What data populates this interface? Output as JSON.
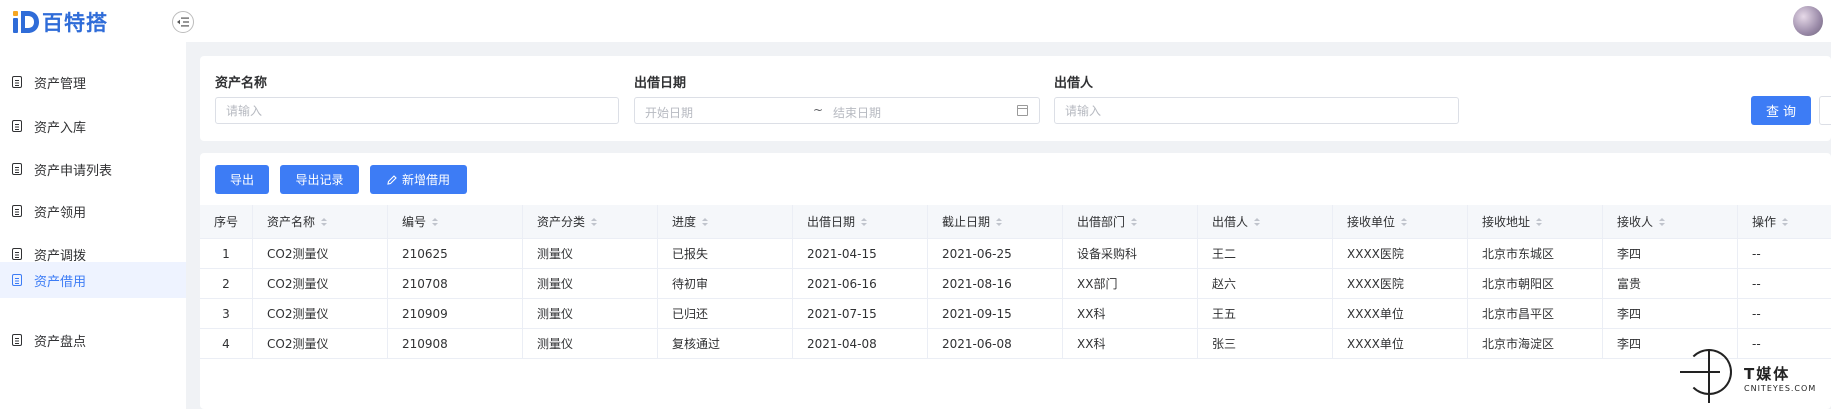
{
  "app": {
    "logo_text": "百特搭",
    "brand_color": "#3d7cf5"
  },
  "sidebar": {
    "items": [
      {
        "label": "资产管理",
        "active": false
      },
      {
        "label": "资产入库",
        "active": false
      },
      {
        "label": "资产申请列表",
        "active": false
      },
      {
        "label": "资产领用",
        "active": false
      },
      {
        "label": "资产调拨",
        "active": false
      },
      {
        "label": "资产借用",
        "active": true
      },
      {
        "label": "资产盘点",
        "active": false
      }
    ]
  },
  "filter": {
    "asset_name_label": "资产名称",
    "asset_name_placeholder": "请输入",
    "lend_date_label": "出借日期",
    "start_date_placeholder": "开始日期",
    "range_separator": "~",
    "end_date_placeholder": "结束日期",
    "lender_label": "出借人",
    "lender_placeholder": "请输入",
    "query_label": "查询"
  },
  "toolbar": {
    "export_label": "导出",
    "export_records_label": "导出记录",
    "add_borrow_label": "新增借用"
  },
  "table": {
    "columns": [
      "序号",
      "资产名称",
      "编号",
      "资产分类",
      "进度",
      "出借日期",
      "截止日期",
      "出借部门",
      "出借人",
      "接收单位",
      "接收地址",
      "接收人",
      "操作"
    ],
    "rows": [
      [
        "1",
        "CO2测量仪",
        "210625",
        "测量仪",
        "已报失",
        "2021-04-15",
        "2021-06-25",
        "设备采购科",
        "王二",
        "XXXX医院",
        "北京市东城区",
        "李四",
        "--"
      ],
      [
        "2",
        "CO2测量仪",
        "210708",
        "测量仪",
        "待初审",
        "2021-06-16",
        "2021-08-16",
        "XX部门",
        "赵六",
        "XXXX医院",
        "北京市朝阳区",
        "富贵",
        "--"
      ],
      [
        "3",
        "CO2测量仪",
        "210909",
        "测量仪",
        "已归还",
        "2021-07-15",
        "2021-09-15",
        "XX科",
        "王五",
        "XXXX单位",
        "北京市昌平区",
        "李四",
        "--"
      ],
      [
        "4",
        "CO2测量仪",
        "210908",
        "测量仪",
        "复核通过",
        "2021-04-08",
        "2021-06-08",
        "XX科",
        "张三",
        "XXXX单位",
        "北京市海淀区",
        "李四",
        "--"
      ]
    ]
  },
  "watermark": {
    "title": "T媒体",
    "subtitle": "CNITEYES.COM"
  }
}
